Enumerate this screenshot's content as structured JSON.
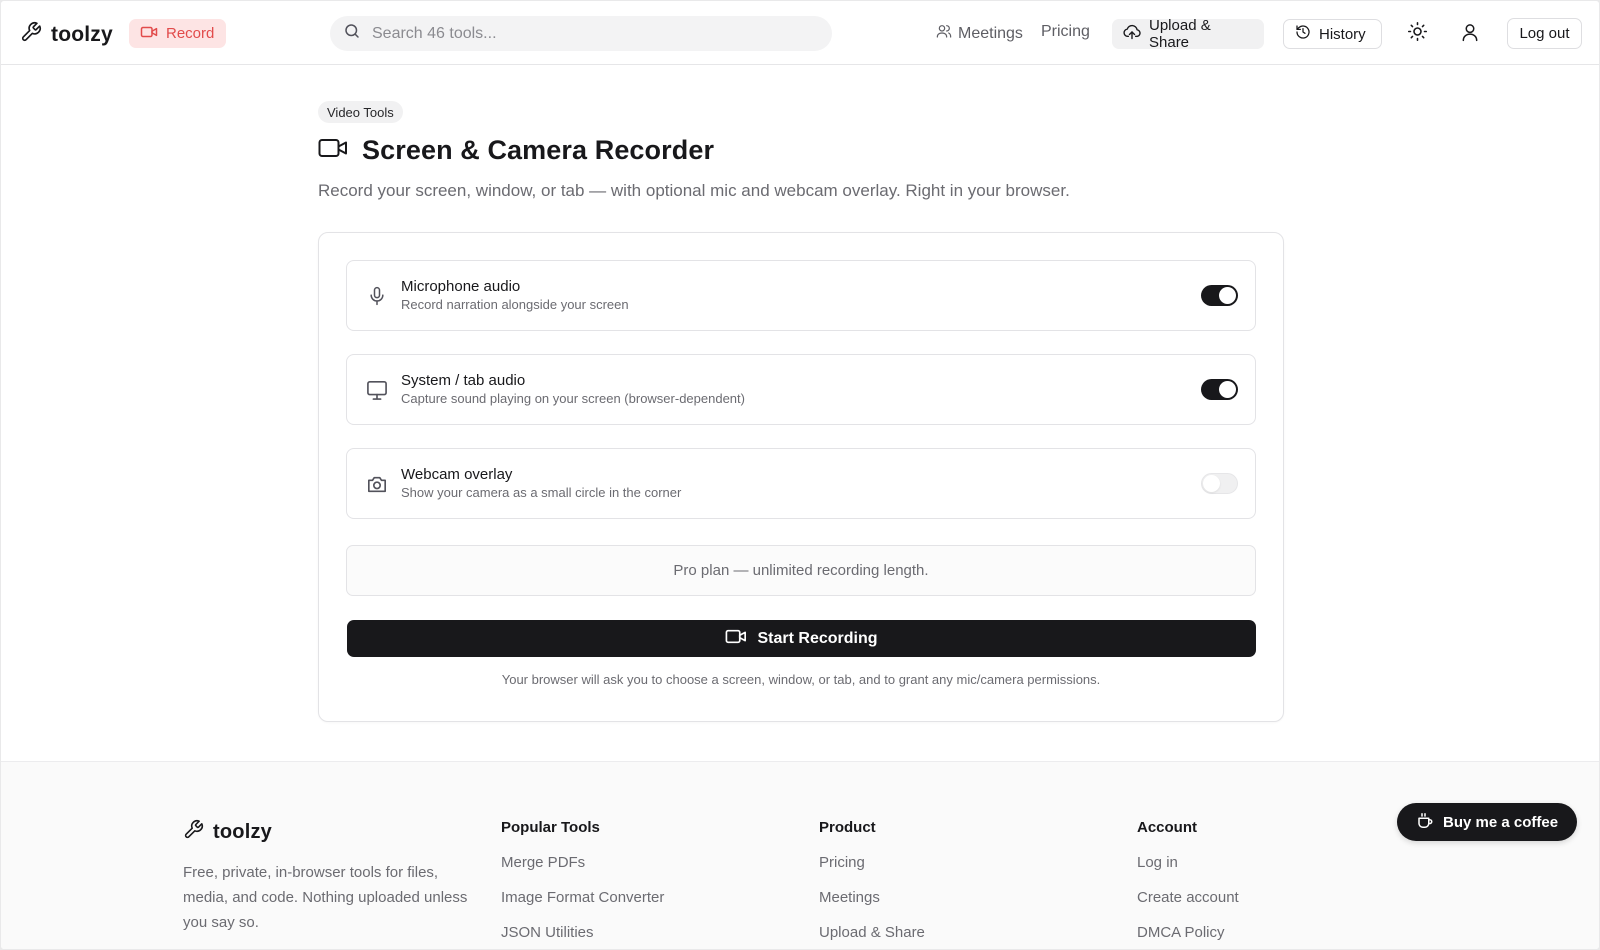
{
  "header": {
    "logo_text": "toolzy",
    "record_label": "Record",
    "search_placeholder": "Search 46 tools...",
    "nav": {
      "meetings": "Meetings",
      "pricing": "Pricing",
      "upload_share": "Upload & Share",
      "history": "History",
      "logout": "Log out"
    }
  },
  "page": {
    "category_badge": "Video Tools",
    "title": "Screen & Camera Recorder",
    "subtitle": "Record your screen, window, or tab — with optional mic and webcam overlay. Right in your browser."
  },
  "options": [
    {
      "title": "Microphone audio",
      "description": "Record narration alongside your screen",
      "enabled": true,
      "icon": "microphone-icon"
    },
    {
      "title": "System / tab audio",
      "description": "Capture sound playing on your screen (browser-dependent)",
      "enabled": true,
      "icon": "monitor-icon"
    },
    {
      "title": "Webcam overlay",
      "description": "Show your camera as a small circle in the corner",
      "enabled": false,
      "icon": "camera-icon"
    }
  ],
  "plan_note": "Pro plan — unlimited recording length.",
  "start_button": "Start Recording",
  "permission_hint": "Your browser will ask you to choose a screen, window, or tab, and to grant any mic/camera permissions.",
  "footer": {
    "logo_text": "toolzy",
    "tagline": "Free, private, in-browser tools for files, media, and code. Nothing uploaded unless you say so.",
    "columns": [
      {
        "heading": "Popular Tools",
        "links": [
          "Merge PDFs",
          "Image Format Converter",
          "JSON Utilities"
        ]
      },
      {
        "heading": "Product",
        "links": [
          "Pricing",
          "Meetings",
          "Upload & Share"
        ]
      },
      {
        "heading": "Account",
        "links": [
          "Log in",
          "Create account",
          "DMCA Policy"
        ]
      }
    ],
    "coffee_button": "Buy me a coffee"
  },
  "colors": {
    "accent_red": "#e24b4b",
    "record_pill_bg": "#fde4e4",
    "primary_dark": "#18181b",
    "muted_text": "#6b6b71"
  }
}
